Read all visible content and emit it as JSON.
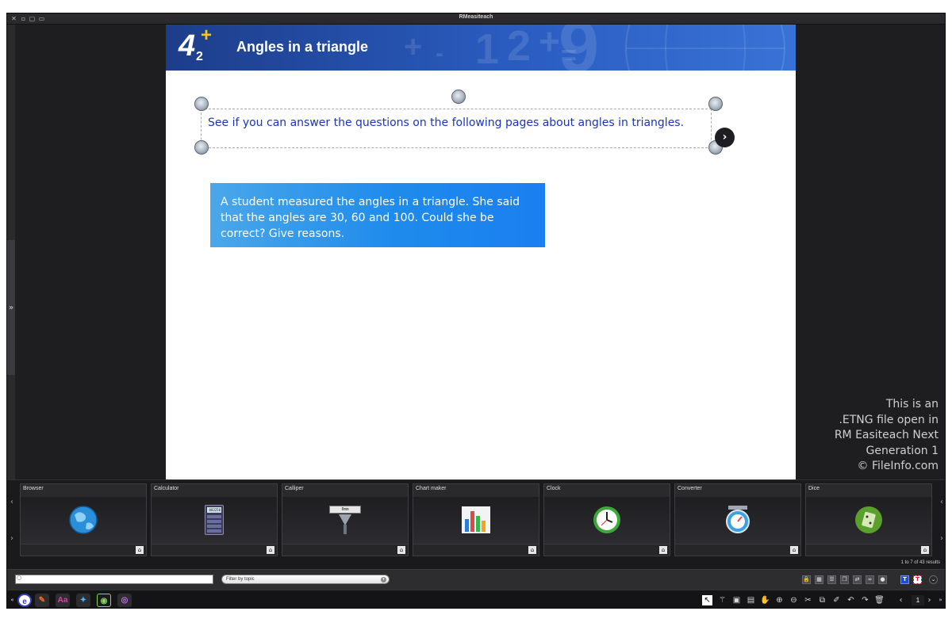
{
  "window": {
    "title": "RMeasiteach"
  },
  "slide": {
    "title": "Angles in a triangle",
    "logo": {
      "number": "4",
      "subscript": "2",
      "symbol": "+"
    },
    "header_decorations": [
      "+",
      "-",
      "1",
      "2",
      "+",
      "9",
      "="
    ],
    "intro_text": "See if you can answer the questions on the following pages about angles in triangles.",
    "question_text": "A student measured the angles in a triangle. She said that the angles are 30, 60 and 100. Could she be correct? Give reasons.",
    "next_glyph": "›"
  },
  "watermark": {
    "lines": [
      "This is an",
      ".ETNG file open in",
      "RM Easiteach Next",
      "Generation 1",
      "© FileInfo.com"
    ]
  },
  "resources": {
    "items": [
      {
        "label": "Browser",
        "icon": "globe-icon"
      },
      {
        "label": "Calculator",
        "icon": "calculator-icon",
        "display": "003250"
      },
      {
        "label": "Calliper",
        "icon": "calliper-icon",
        "display": "0mm"
      },
      {
        "label": "Chart maker",
        "icon": "bar-chart-icon"
      },
      {
        "label": "Clock",
        "icon": "clock-icon"
      },
      {
        "label": "Converter",
        "icon": "scale-icon"
      },
      {
        "label": "Dice",
        "icon": "dice-icon"
      }
    ],
    "results_text": "1 to 7 of 43 results",
    "home_glyph": "⌂",
    "prev_glyph": "‹",
    "next_glyph": "›"
  },
  "search": {
    "placeholder": "",
    "filter_placeholder": "Filter by topic"
  },
  "left_panel": {
    "expand_glyph": "»"
  },
  "bottom_toolbar": {
    "page_number": "1",
    "prev_glyph": "‹",
    "next_glyph": "›"
  },
  "colors": {
    "header_blue": "#2a5cc0",
    "intro_text": "#1c35b8",
    "question_box": "#1e8bec",
    "window_bg": "#1f1f21"
  }
}
